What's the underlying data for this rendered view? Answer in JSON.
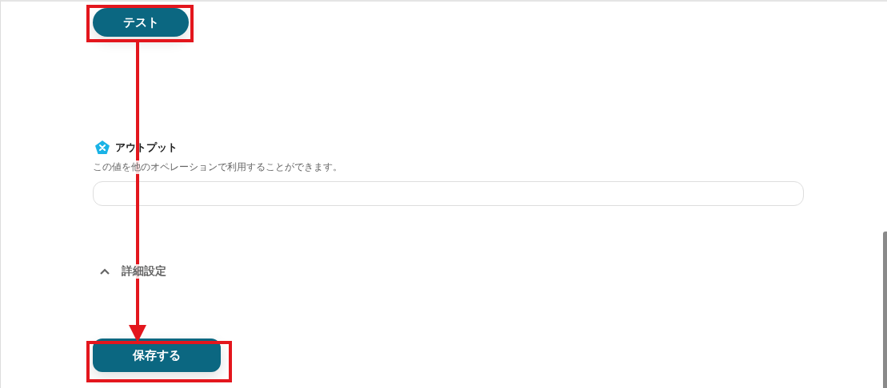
{
  "test_button": {
    "label": "テスト"
  },
  "output": {
    "title": "アウトプット",
    "description": "この値を他のオペレーションで利用することができます。"
  },
  "advanced": {
    "label": "詳細設定",
    "expanded": true
  },
  "save_button": {
    "label": "保存する"
  }
}
